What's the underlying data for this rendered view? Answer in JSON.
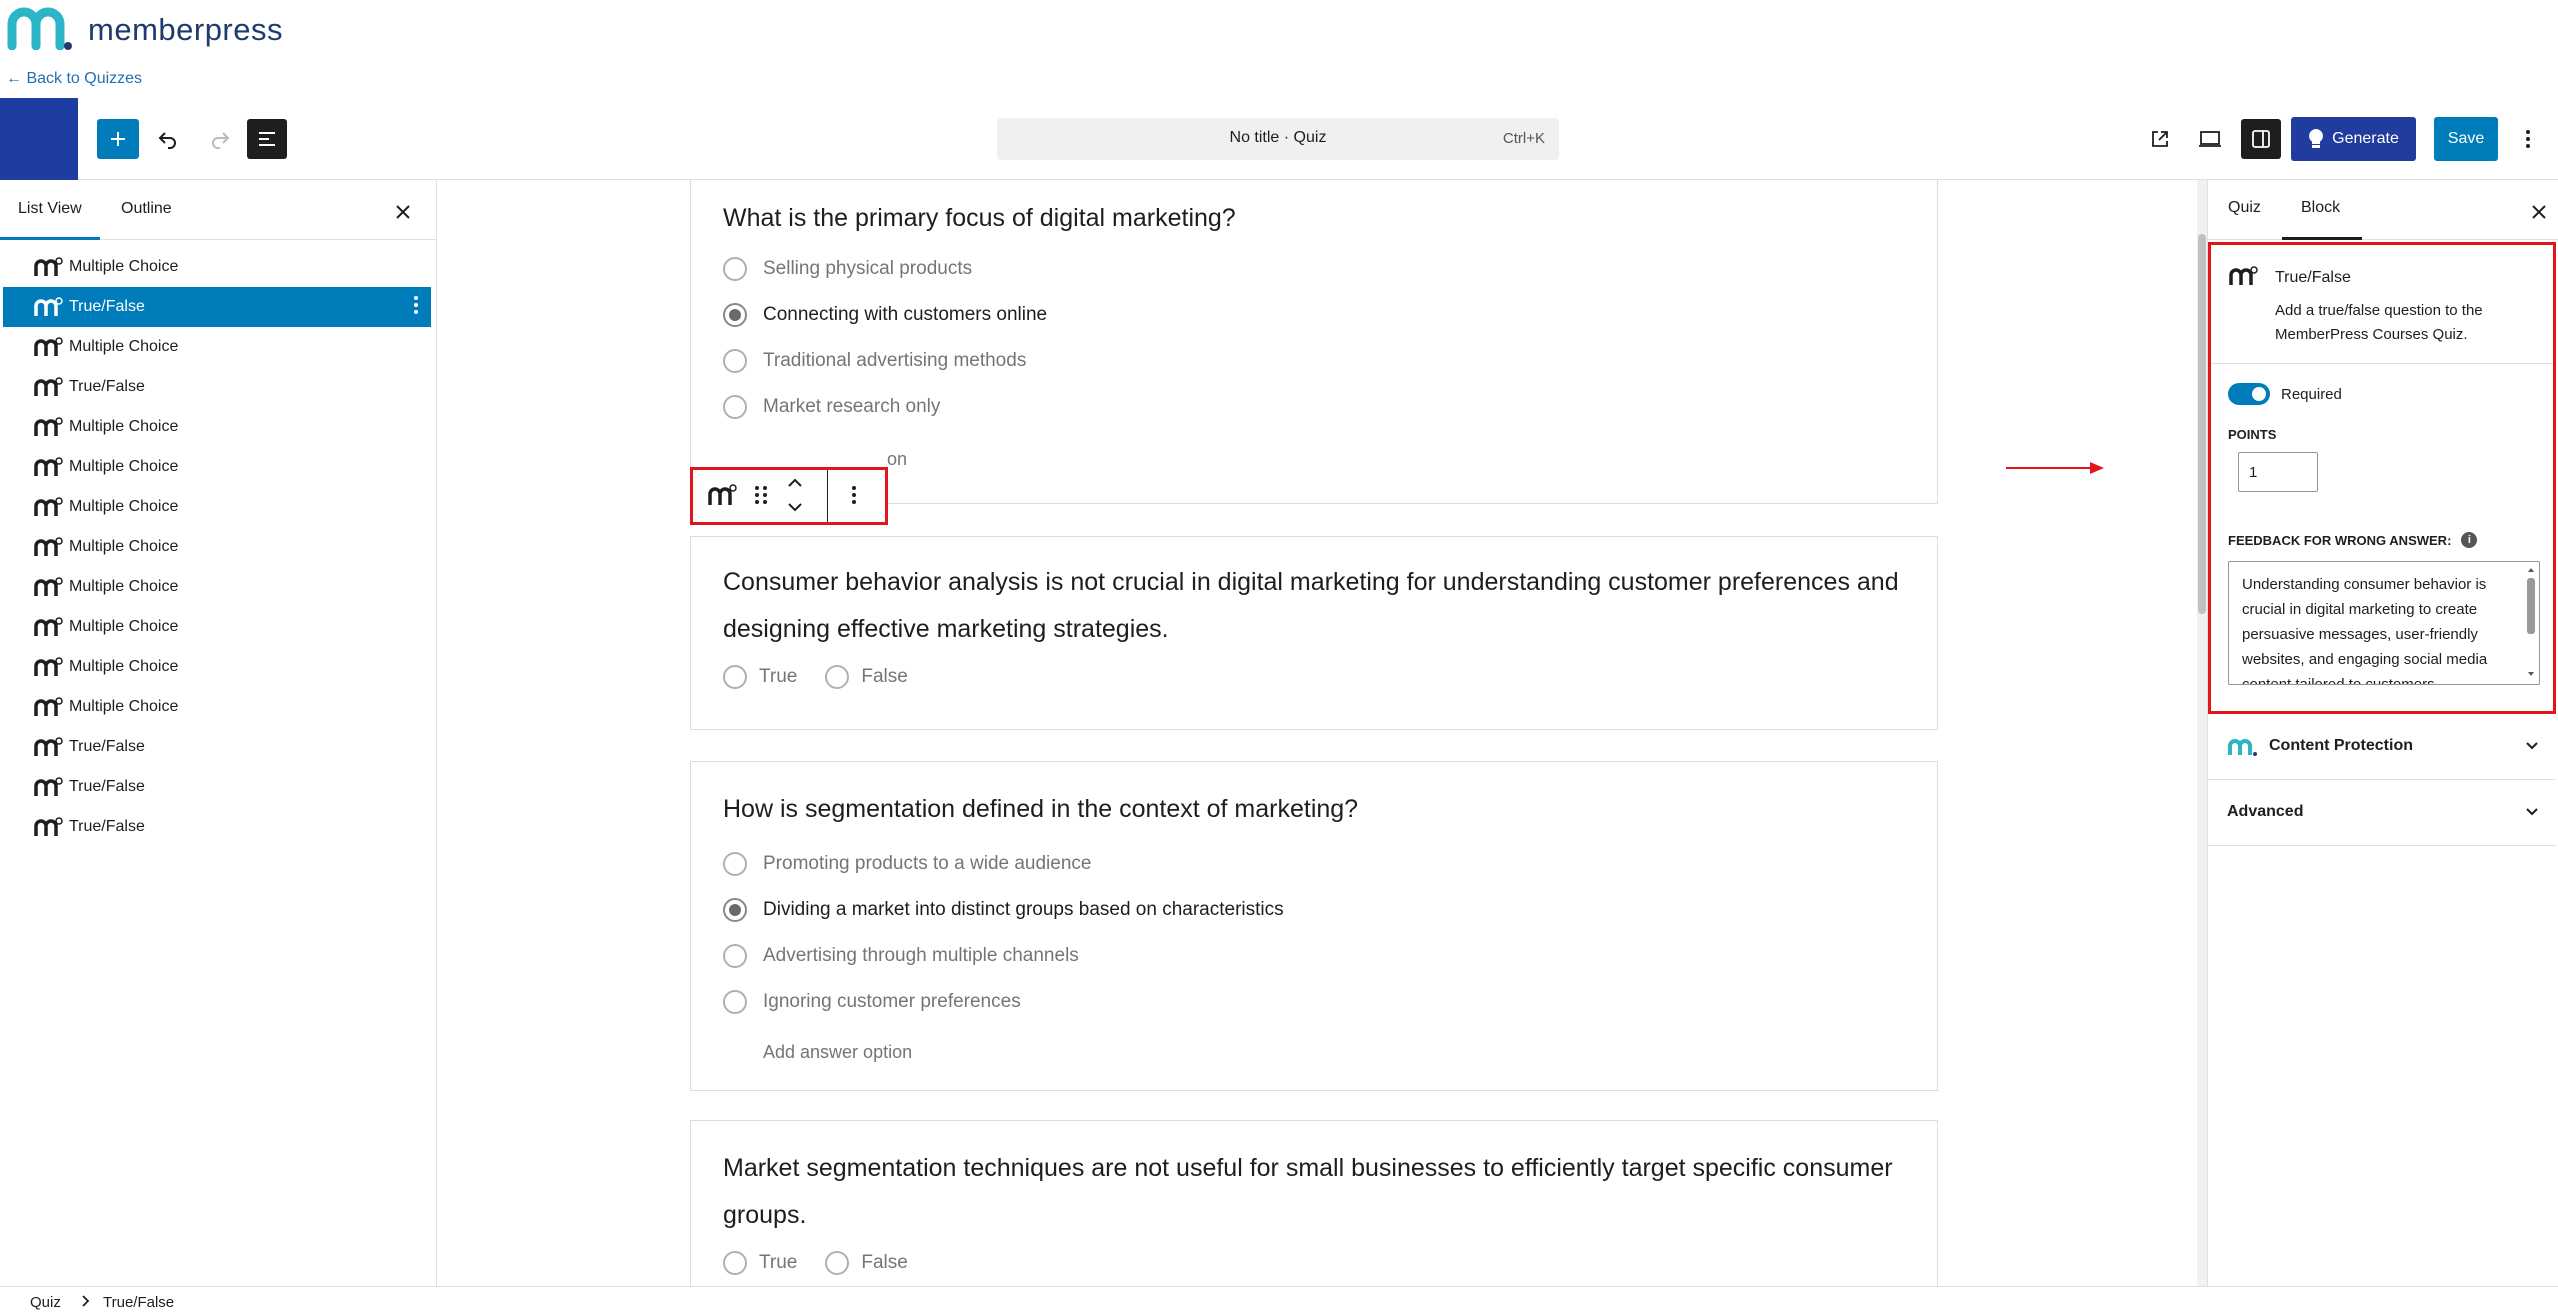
{
  "brand": {
    "name": "memberpress",
    "back_link": "← Back to Quizzes"
  },
  "toolbar": {
    "command_title": "No title · Quiz",
    "command_shortcut": "Ctrl+K",
    "generate_label": "Generate",
    "save_label": "Save"
  },
  "left_panel": {
    "tabs": [
      "List View",
      "Outline"
    ],
    "items": [
      {
        "label": "Multiple Choice",
        "selected": false
      },
      {
        "label": "True/False",
        "selected": true
      },
      {
        "label": "Multiple Choice",
        "selected": false
      },
      {
        "label": "True/False",
        "selected": false
      },
      {
        "label": "Multiple Choice",
        "selected": false
      },
      {
        "label": "Multiple Choice",
        "selected": false
      },
      {
        "label": "Multiple Choice",
        "selected": false
      },
      {
        "label": "Multiple Choice",
        "selected": false
      },
      {
        "label": "Multiple Choice",
        "selected": false
      },
      {
        "label": "Multiple Choice",
        "selected": false
      },
      {
        "label": "Multiple Choice",
        "selected": false
      },
      {
        "label": "Multiple Choice",
        "selected": false
      },
      {
        "label": "True/False",
        "selected": false
      },
      {
        "label": "True/False",
        "selected": false
      },
      {
        "label": "True/False",
        "selected": false
      }
    ]
  },
  "canvas": {
    "q1": {
      "title": "What is the primary focus of digital marketing?",
      "options": [
        "Selling physical products",
        "Connecting with customers online",
        "Traditional advertising methods",
        "Market research only"
      ],
      "selected_index": 1,
      "add_option_partial": "on"
    },
    "q2": {
      "title": "Consumer behavior analysis is not crucial in digital marketing for understanding customer preferences and designing effective marketing strategies.",
      "true_label": "True",
      "false_label": "False"
    },
    "q3": {
      "title": "How is segmentation defined in the context of marketing?",
      "options": [
        "Promoting products to a wide audience",
        "Dividing a market into distinct groups based on characteristics",
        "Advertising through multiple channels",
        "Ignoring customer preferences"
      ],
      "selected_index": 1,
      "add_option": "Add answer option"
    },
    "q4": {
      "title": "Market segmentation techniques are not useful for small businesses to efficiently target specific consumer groups.",
      "true_label": "True",
      "false_label": "False"
    }
  },
  "right_panel": {
    "tabs": [
      "Quiz",
      "Block"
    ],
    "block_title": "True/False",
    "block_description": "Add a true/false question to the MemberPress Courses Quiz.",
    "required_label": "Required",
    "points_label": "POINTS",
    "points_value": "1",
    "feedback_label": "FEEDBACK FOR WRONG ANSWER:",
    "feedback_text": "Understanding consumer behavior is crucial in digital marketing to create persuasive messages, user-friendly websites, and engaging social media content tailored to customers.",
    "content_protection_label": "Content Protection",
    "advanced_label": "Advanced"
  },
  "footer": {
    "crumbs": [
      "Quiz",
      "True/False"
    ]
  },
  "colors": {
    "accent": "#007cba",
    "brand_teal": "#2bb5c7",
    "brand_navy": "#1f3b6e",
    "highlight_red": "#e0161a"
  }
}
